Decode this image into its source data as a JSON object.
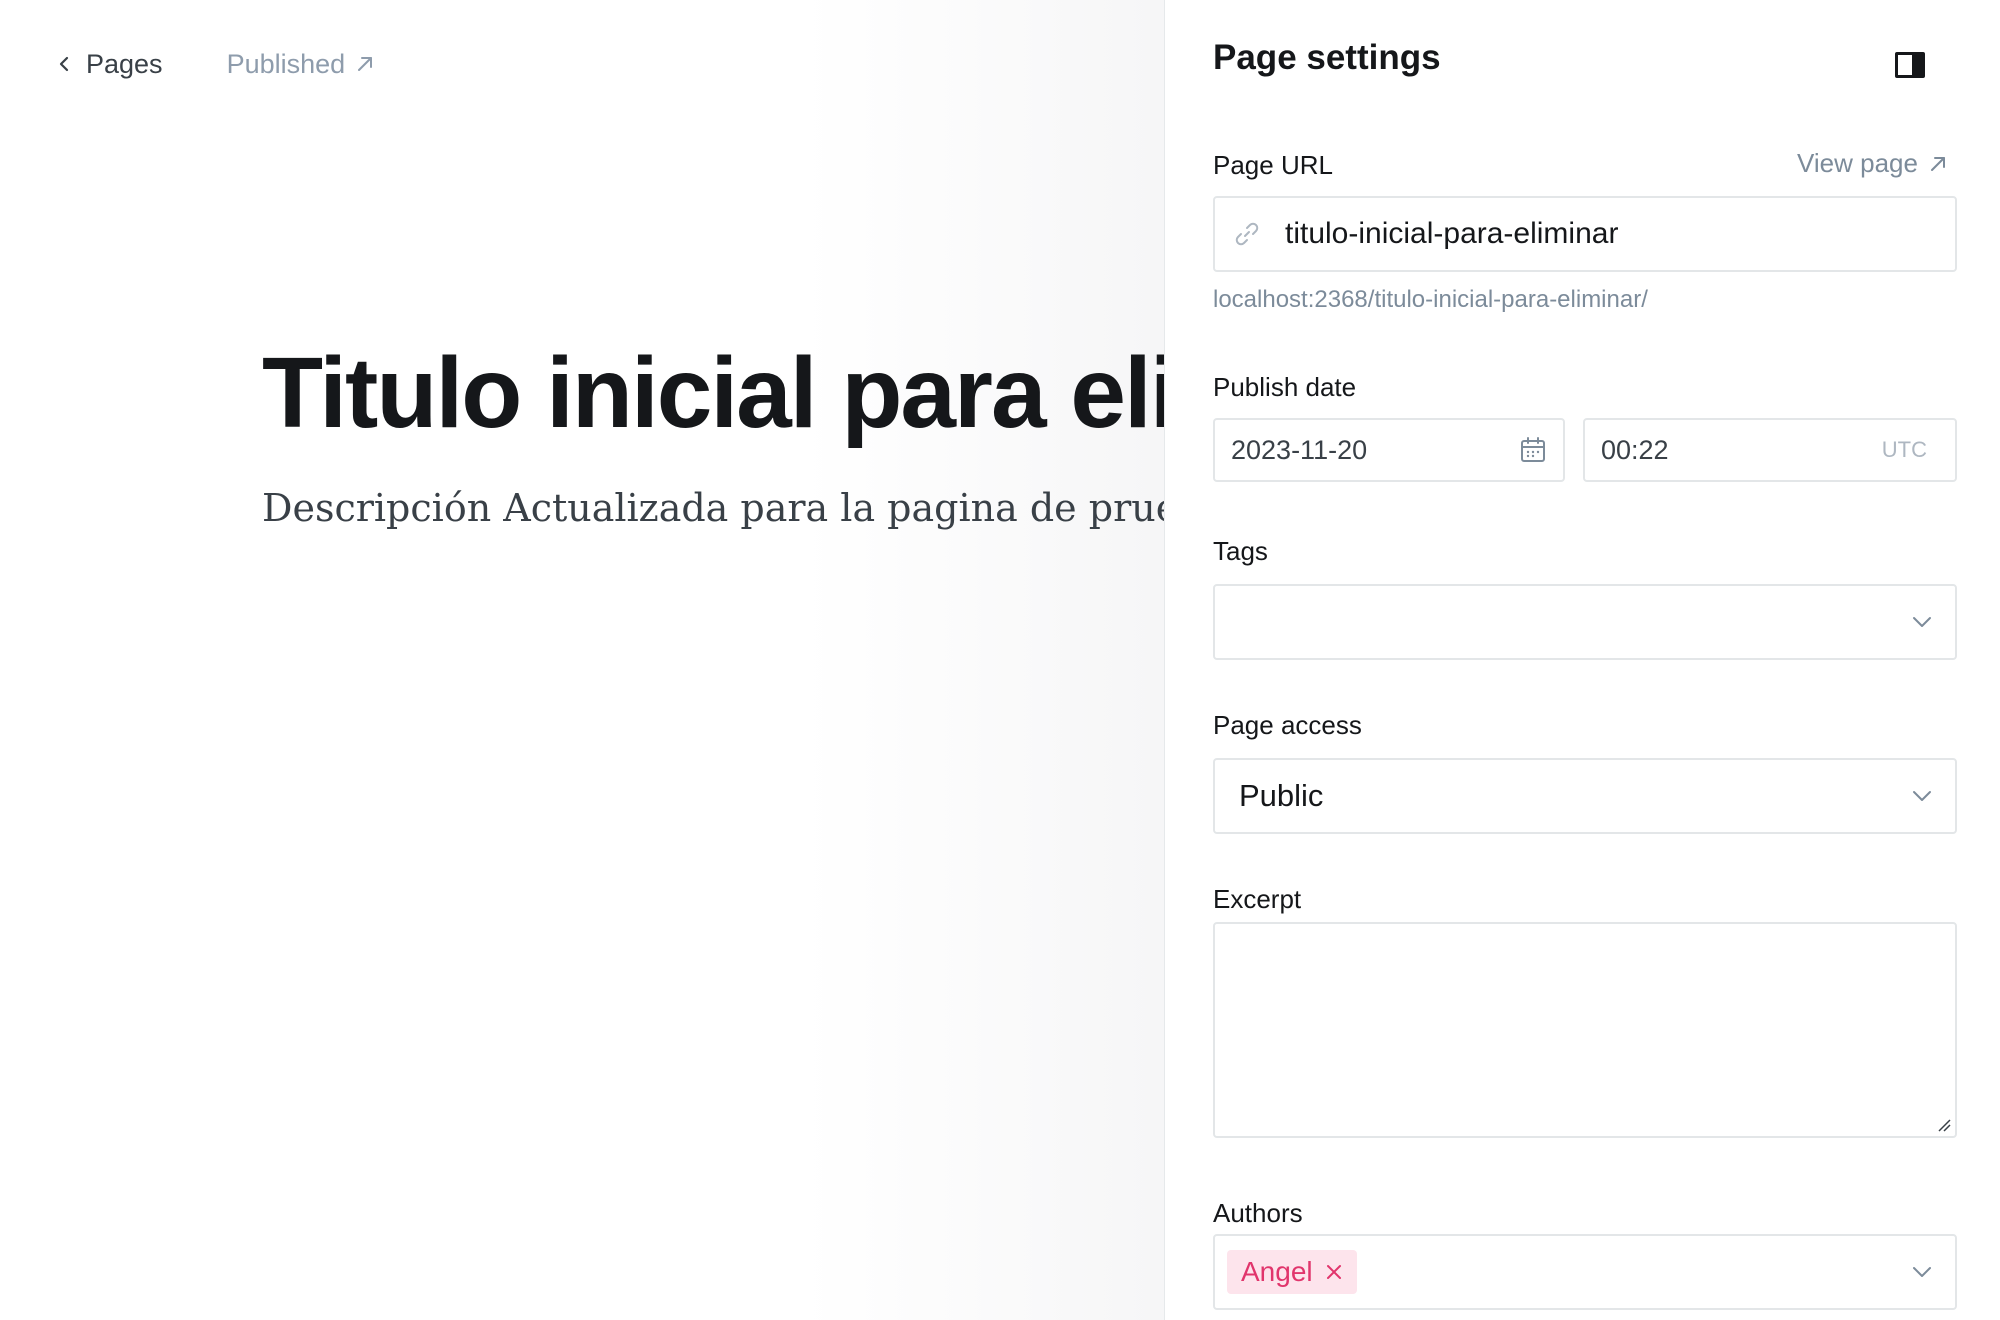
{
  "editor": {
    "back_label": "Pages",
    "status_label": "Published",
    "title": "Titulo inicial para eli",
    "description": "Descripción Actualizada para la pagina de prueba a"
  },
  "settings": {
    "title": "Page settings",
    "url": {
      "label": "Page URL",
      "view_page_label": "View page",
      "value": "titulo-inicial-para-eliminar",
      "hint": "localhost:2368/titulo-inicial-para-eliminar/"
    },
    "publish_date": {
      "label": "Publish date",
      "date": "2023-11-20",
      "time": "00:22",
      "timezone": "UTC"
    },
    "tags": {
      "label": "Tags",
      "value": ""
    },
    "access": {
      "label": "Page access",
      "value": "Public"
    },
    "excerpt": {
      "label": "Excerpt",
      "value": ""
    },
    "authors": {
      "label": "Authors",
      "items": [
        "Angel"
      ]
    }
  },
  "colors": {
    "accent_pink": "#e1356c",
    "tag_bg": "#fde4ec",
    "border": "#e3e6e8",
    "muted_text": "#7c8b9a"
  },
  "icons": {
    "back": "chevron-left-icon",
    "status": "arrow-up-right-icon",
    "sidebar_toggle": "sidebar-toggle-icon",
    "url": "link-icon",
    "date": "calendar-icon",
    "select": "chevron-down-icon",
    "remove": "close-icon"
  }
}
